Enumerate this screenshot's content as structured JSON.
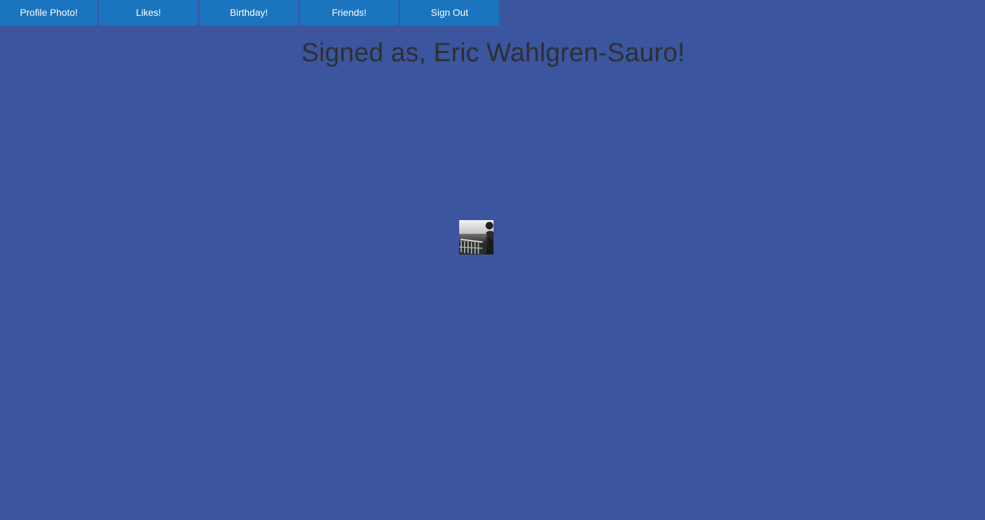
{
  "nav": {
    "buttons": [
      {
        "label": "Profile Photo!"
      },
      {
        "label": "Likes!"
      },
      {
        "label": "Birthday!"
      },
      {
        "label": "Friends!"
      },
      {
        "label": "Sign Out"
      }
    ]
  },
  "greeting": {
    "prefix": "Signed as, ",
    "name": "Eric Wahlgren-Sauro!"
  },
  "colors": {
    "background": "#3b559e",
    "button": "#1b74be",
    "button_text": "#ffffff",
    "heading": "#2e2f33"
  },
  "profile_photo": {
    "icon": "profile-photo",
    "style": "black-and-white"
  }
}
